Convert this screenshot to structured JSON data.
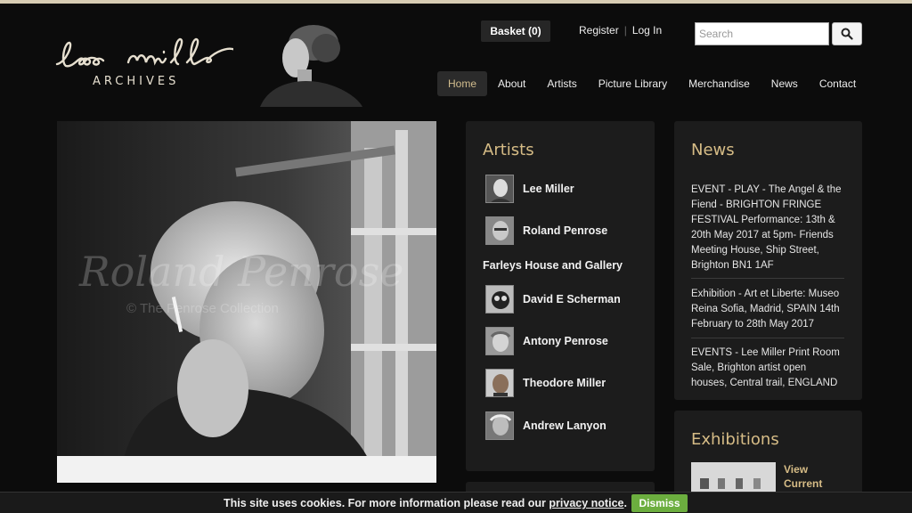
{
  "brand": {
    "script": "lee miller",
    "subtitle": "ARCHIVES"
  },
  "header": {
    "basket_label": "Basket (0)",
    "register_label": "Register",
    "login_label": "Log In",
    "search_placeholder": "Search",
    "search_icon": "magnifier-icon"
  },
  "nav": {
    "items": [
      {
        "label": "Home",
        "active": true
      },
      {
        "label": "About"
      },
      {
        "label": "Artists"
      },
      {
        "label": "Picture Library"
      },
      {
        "label": "Merchandise"
      },
      {
        "label": "News"
      },
      {
        "label": "Contact"
      }
    ]
  },
  "hero": {
    "watermark_name": "Roland Penrose",
    "watermark_copyright": "© The Penrose Collection"
  },
  "artists": {
    "title": "Artists",
    "items": [
      {
        "name": "Lee Miller"
      },
      {
        "name": "Roland Penrose"
      },
      {
        "name": "Farleys House and Gallery"
      },
      {
        "name": "David E Scherman"
      },
      {
        "name": "Antony Penrose"
      },
      {
        "name": "Theodore Miller"
      },
      {
        "name": "Andrew Lanyon"
      }
    ]
  },
  "news": {
    "title": "News",
    "items": [
      "EVENT - PLAY - The Angel & the Fiend - BRIGHTON FRINGE FESTIVAL Performance: 13th & 20th May 2017 at 5pm- Friends Meeting House, Ship Street, Brighton BN1 1AF",
      "Exhibition - Art et Liberte: Museo Reina Sofia, Madrid, SPAIN 14th February to 28th May 2017",
      "EVENTS - Lee Miller Print Room Sale, Brighton artist open houses, Central trail, ENGLAND"
    ]
  },
  "exhibitions": {
    "title": "Exhibitions",
    "link_label": "View Current"
  },
  "cookie": {
    "text": "This site uses cookies. For more information please read our",
    "link": "privacy notice",
    "suffix": ".",
    "dismiss_label": "Dismiss"
  },
  "colors": {
    "accent": "#d6bc86",
    "background": "#0c0c0c",
    "panel": "#1c1c1c",
    "dismiss": "#6cae3f"
  }
}
